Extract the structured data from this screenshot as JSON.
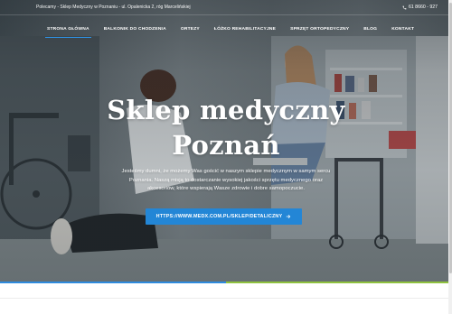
{
  "topbar": {
    "info": "Polecamy - Sklep Medyczny w Poznaniu - ul. Opalenicka 2, róg Marcelińskiej",
    "phone": "61 8660 - 927",
    "phone_icon": "phone-icon"
  },
  "nav": {
    "items": [
      {
        "label": "STRONA GŁÓWNA"
      },
      {
        "label": "BALKONIK DO CHODZENIA"
      },
      {
        "label": "ORTEZY"
      },
      {
        "label": "ŁÓŻKO REHABILITACYJNE"
      },
      {
        "label": "SPRZĘT ORTOPEDYCZNY"
      },
      {
        "label": "BLOG"
      },
      {
        "label": "KONTAKT"
      }
    ],
    "active_index": 0
  },
  "hero": {
    "title_line1": "Sklep medyczny",
    "title_line2": "Poznań",
    "description": "Jesteśmy dumni, że możemy Was gościć w naszym sklepie medycznym w samym sercu Poznania. Naszą misją to dostarczanie wysokiej jakości sprzętu medycznego oraz akcesoriów, które wspierają Wasze zdrowie i dobre samopoczucie.",
    "cta_label": "HTTPS://WWW.MEDX.COM.PL/SKLEP/DETALICZNY",
    "cta_icon": "arrow-right-icon"
  },
  "colors": {
    "accent_blue": "#2386d6",
    "accent_green": "#8fc23f",
    "nav_active_underline": "#2f8fe0"
  }
}
